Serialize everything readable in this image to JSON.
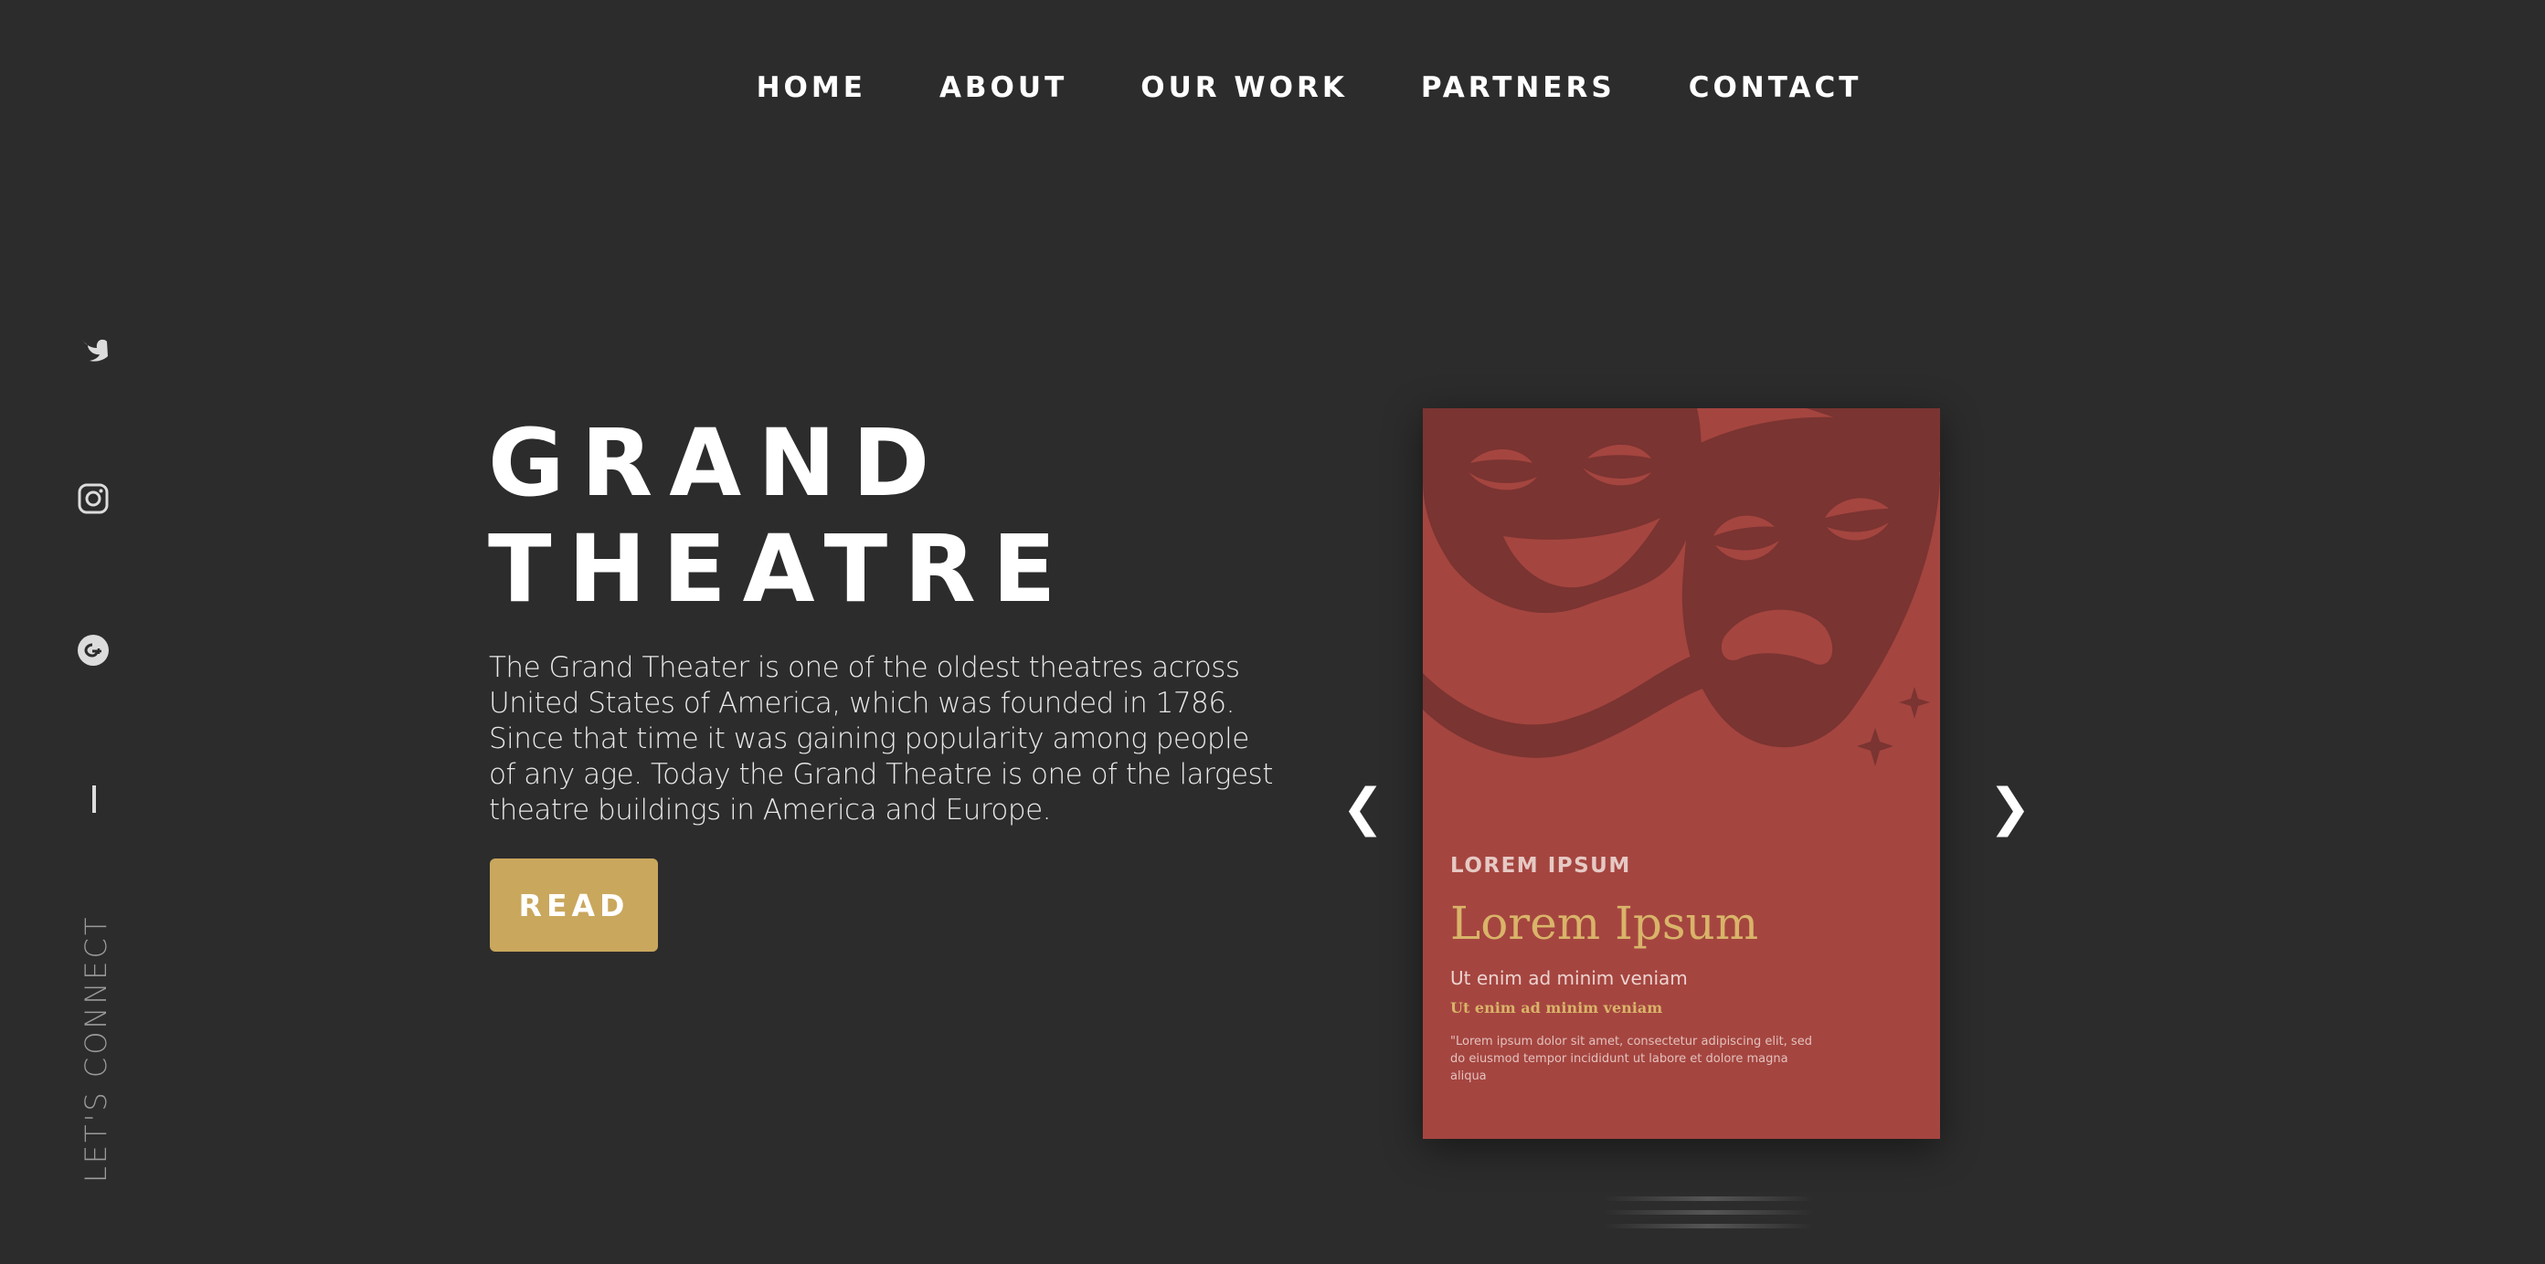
{
  "nav": {
    "items": [
      {
        "label": "HOME"
      },
      {
        "label": "ABOUT"
      },
      {
        "label": "OUR WORK"
      },
      {
        "label": "PARTNERS"
      },
      {
        "label": "CONTACT"
      }
    ]
  },
  "sidebar": {
    "icons": [
      "twitter-icon",
      "instagram-icon",
      "google-plus-icon"
    ],
    "lets_connect": "LET'S CONNECT"
  },
  "hero": {
    "title_line1": "GRAND",
    "title_line2": "THEATRE",
    "description": "The Grand Theater is one of the oldest theatres across United States of America, which was founded in 1786. Since that time it was gaining popularity among people of any age. Today the Grand Theatre is one of the largest theatre buildings in America and Europe.",
    "button_label": "READ"
  },
  "slider": {
    "prev_label": "❮",
    "next_label": "❯",
    "poster": {
      "eyebrow": "LOREM IPSUM",
      "title": "Lorem Ipsum",
      "subtitle": "Ut enim ad minim veniam",
      "subtitle_alt": "Ut enim ad minim veniam",
      "quote": "\"Lorem ipsum dolor sit amet, consectetur adipiscing elit, sed do eiusmod tempor incididunt ut labore et dolore magna aliqua"
    }
  },
  "colors": {
    "background": "#2c2c2c",
    "accent_gold": "#c9a75d",
    "poster_red": "#a54540"
  }
}
